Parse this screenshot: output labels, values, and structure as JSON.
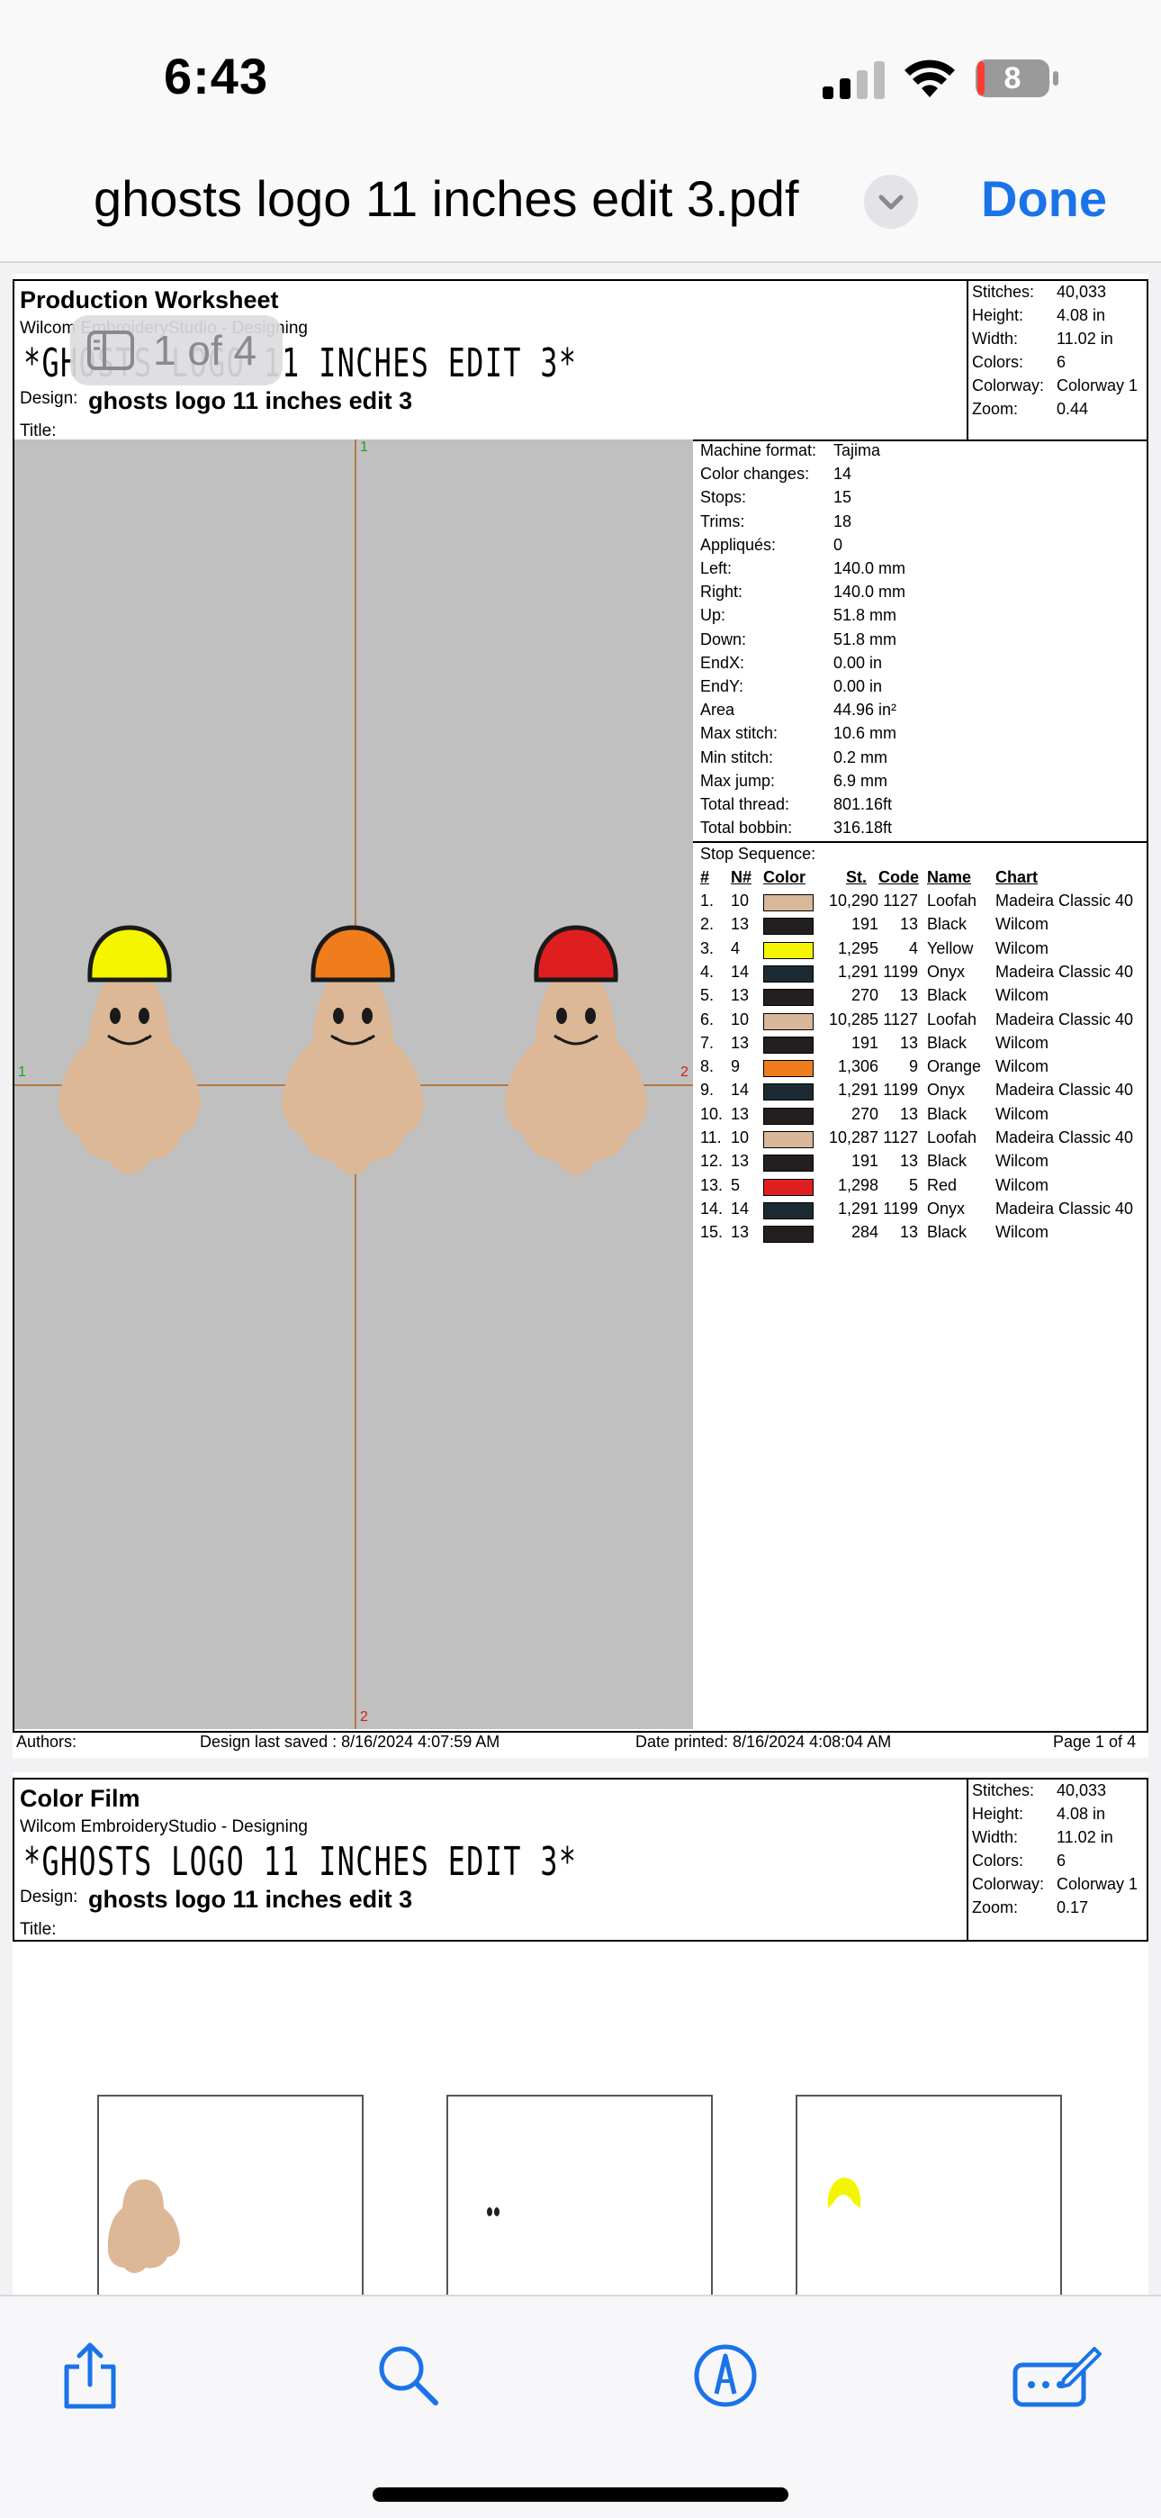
{
  "status_bar": {
    "time": "6:43",
    "battery": "8"
  },
  "nav": {
    "title": "ghosts logo 11 inches edit 3.pdf",
    "done_label": "Done"
  },
  "page_indicator": "1 of 4",
  "page1": {
    "title": "Production Worksheet",
    "subtitle": "Wilcom EmbroideryStudio - Designing",
    "design_name_big": "*GHOSTS LOGO 11 INCHES EDIT 3*",
    "design_label": "Design:",
    "design_value": "ghosts logo 11 inches edit 3",
    "title_label": "Title:",
    "stats": [
      {
        "k": "Stitches:",
        "v": "40,033"
      },
      {
        "k": "Height:",
        "v": "4.08 in"
      },
      {
        "k": "Width:",
        "v": "11.02 in"
      },
      {
        "k": "Colors:",
        "v": "6"
      },
      {
        "k": "Colorway:",
        "v": "Colorway 1"
      },
      {
        "k": "Zoom:",
        "v": "0.44"
      }
    ],
    "machine_info": [
      {
        "k": "Machine format:",
        "v": "Tajima"
      },
      {
        "k": "Color changes:",
        "v": "14"
      },
      {
        "k": "Stops:",
        "v": "15"
      },
      {
        "k": "Trims:",
        "v": "18"
      },
      {
        "k": "Appliqués:",
        "v": "0"
      },
      {
        "k": "Left:",
        "v": "140.0 mm"
      },
      {
        "k": "Right:",
        "v": "140.0 mm"
      },
      {
        "k": "Up:",
        "v": "51.8 mm"
      },
      {
        "k": "Down:",
        "v": "51.8 mm"
      },
      {
        "k": "EndX:",
        "v": "0.00 in"
      },
      {
        "k": "EndY:",
        "v": "0.00 in"
      },
      {
        "k": "Area",
        "v": " 44.96 in²"
      },
      {
        "k": "Max stitch:",
        "v": "10.6 mm"
      },
      {
        "k": "Min stitch:",
        "v": "0.2 mm"
      },
      {
        "k": "Max jump:",
        "v": "6.9 mm"
      },
      {
        "k": "Total thread:",
        "v": "801.16ft"
      },
      {
        "k": "Total bobbin:",
        "v": "316.18ft"
      }
    ],
    "stop_sequence_label": "Stop Sequence:",
    "stop_headers": {
      "num": "#",
      "n": "N#",
      "color": "Color",
      "st": "St.",
      "code": "Code",
      "name": "Name",
      "chart": "Chart"
    },
    "stops": [
      {
        "num": "1.",
        "n": "10",
        "color": "#d9b79a",
        "st": "10,290",
        "code": "1127",
        "name": "Loofah",
        "chart": "Madeira Classic 40"
      },
      {
        "num": "2.",
        "n": "13",
        "color": "#231f1e",
        "st": "191",
        "code": "13",
        "name": "Black",
        "chart": "Wilcom"
      },
      {
        "num": "3.",
        "n": "4",
        "color": "#f5f500",
        "st": "1,295",
        "code": "4",
        "name": "Yellow",
        "chart": "Wilcom"
      },
      {
        "num": "4.",
        "n": "14",
        "color": "#1c2b33",
        "st": "1,291",
        "code": "1199",
        "name": "Onyx",
        "chart": "Madeira Classic 40"
      },
      {
        "num": "5.",
        "n": "13",
        "color": "#231f1e",
        "st": "270",
        "code": "13",
        "name": "Black",
        "chart": "Wilcom"
      },
      {
        "num": "6.",
        "n": "10",
        "color": "#d9b79a",
        "st": "10,285",
        "code": "1127",
        "name": "Loofah",
        "chart": "Madeira Classic 40"
      },
      {
        "num": "7.",
        "n": "13",
        "color": "#231f1e",
        "st": "191",
        "code": "13",
        "name": "Black",
        "chart": "Wilcom"
      },
      {
        "num": "8.",
        "n": "9",
        "color": "#ef7d1b",
        "st": "1,306",
        "code": "9",
        "name": "Orange",
        "chart": "Wilcom"
      },
      {
        "num": "9.",
        "n": "14",
        "color": "#1c2b33",
        "st": "1,291",
        "code": "1199",
        "name": "Onyx",
        "chart": "Madeira Classic 40"
      },
      {
        "num": "10.",
        "n": "13",
        "color": "#231f1e",
        "st": "270",
        "code": "13",
        "name": "Black",
        "chart": "Wilcom"
      },
      {
        "num": "11.",
        "n": "10",
        "color": "#d9b79a",
        "st": "10,287",
        "code": "1127",
        "name": "Loofah",
        "chart": "Madeira Classic 40"
      },
      {
        "num": "12.",
        "n": "13",
        "color": "#231f1e",
        "st": "191",
        "code": "13",
        "name": "Black",
        "chart": "Wilcom"
      },
      {
        "num": "13.",
        "n": "5",
        "color": "#df1f1f",
        "st": "1,298",
        "code": "5",
        "name": "Red",
        "chart": "Wilcom"
      },
      {
        "num": "14.",
        "n": "14",
        "color": "#1c2b33",
        "st": "1,291",
        "code": "1199",
        "name": "Onyx",
        "chart": "Madeira Classic 40"
      },
      {
        "num": "15.",
        "n": "13",
        "color": "#231f1e",
        "st": "284",
        "code": "13",
        "name": "Black",
        "chart": "Wilcom"
      }
    ],
    "guide_marks": {
      "top": "1",
      "bottom": "2",
      "left": "1",
      "right": "2"
    },
    "footer": {
      "authors": "Authors:",
      "saved": "Design last saved : 8/16/2024 4:07:59 AM",
      "printed": "Date printed: 8/16/2024 4:08:04 AM",
      "page": "Page 1 of 4"
    }
  },
  "page2": {
    "title": "Color Film",
    "subtitle": "Wilcom EmbroideryStudio - Designing",
    "design_name_big": "*GHOSTS LOGO 11 INCHES EDIT 3*",
    "design_label": "Design:",
    "design_value": "ghosts logo 11 inches edit 3",
    "title_label": "Title:",
    "stats": [
      {
        "k": "Stitches:",
        "v": "40,033"
      },
      {
        "k": "Height:",
        "v": "4.08 in"
      },
      {
        "k": "Width:",
        "v": "11.02 in"
      },
      {
        "k": "Colors:",
        "v": "6"
      },
      {
        "k": "Colorway:",
        "v": "Colorway 1"
      },
      {
        "k": "Zoom:",
        "v": "0.17"
      }
    ]
  },
  "colors": {
    "ghost": "#dcb896",
    "yellow": "#f5f500",
    "orange": "#ef7d1b",
    "red": "#df1f1f",
    "canvas": "#c0c0c0",
    "accent": "#1a73e8"
  },
  "toolbar": {
    "icons": [
      "share-icon",
      "search-icon",
      "markup-icon",
      "annotate-icon"
    ]
  }
}
